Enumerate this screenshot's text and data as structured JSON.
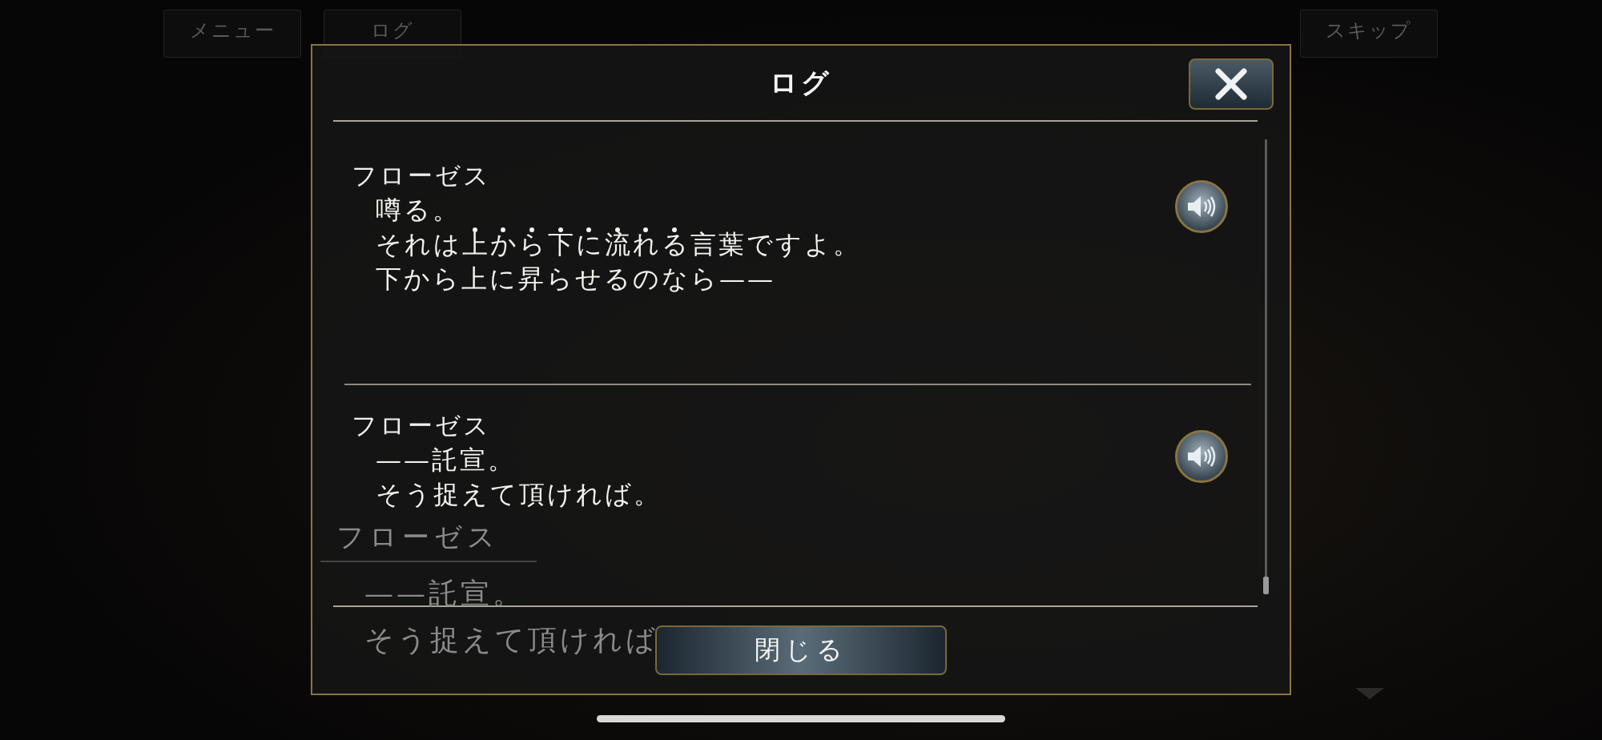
{
  "top_buttons": [
    {
      "label": "メニュー"
    },
    {
      "label": "ログ"
    },
    {
      "label": "スキップ"
    }
  ],
  "background_message": {
    "speaker": "フローゼス",
    "lines": [
      "——託宣。",
      "そう捉えて頂ければ"
    ]
  },
  "log_dialog": {
    "title": "ログ",
    "entries": [
      {
        "speaker": "フローゼス",
        "lines": [
          [
            {
              "text": "噂る。",
              "emphasis": false
            }
          ],
          [
            {
              "text": "それは",
              "emphasis": false
            },
            {
              "text": "上から下に流れる",
              "emphasis": true
            },
            {
              "text": "言葉ですよ。",
              "emphasis": false
            }
          ],
          [
            {
              "text": "下から上に昇らせるのなら——",
              "emphasis": false
            }
          ]
        ]
      },
      {
        "speaker": "フローゼス",
        "lines": [
          [
            {
              "text": "——託宣。",
              "emphasis": false
            }
          ],
          [
            {
              "text": "そう捉えて頂ければ。",
              "emphasis": false
            }
          ]
        ]
      }
    ],
    "close_label": "閉じる"
  }
}
